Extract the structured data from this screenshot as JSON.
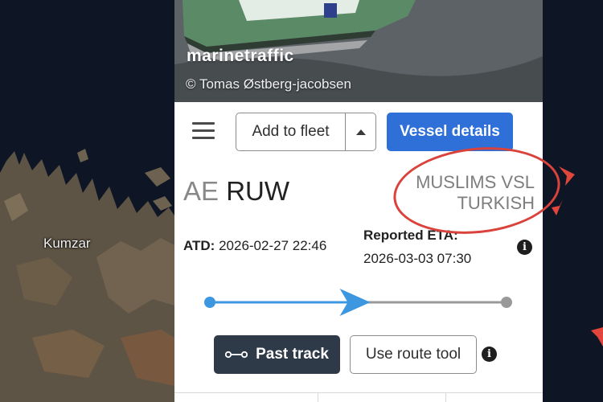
{
  "map": {
    "place_label": "Kumzar",
    "colors": {
      "sea": "#0e1626",
      "land": "#5e5445",
      "marker": "#e0463b"
    },
    "markers": [
      "vessel-marker-icon",
      "vessel-marker-icon",
      "vessel-marker-icon"
    ]
  },
  "photo": {
    "brand": "marinetraffic",
    "credit": "© Tomas Østberg-jacobsen"
  },
  "toolbar": {
    "menu_icon": "hamburger-menu-icon",
    "add_to_fleet_label": "Add to fleet",
    "fleet_dropdown_icon": "caret-up-icon",
    "vessel_details_label": "Vessel details",
    "accent_color": "#2e6fd8"
  },
  "vessel": {
    "flag_code": "AE",
    "name": "RUW",
    "destination_line1": "MUSLIMS VSL",
    "destination_line2": "TURKISH"
  },
  "voyage": {
    "atd_label": "ATD:",
    "atd_value": "2026-02-27 22:46",
    "eta_label": "Reported ETA:",
    "eta_value": "2026-03-03 07:30",
    "progress_fraction": 0.53,
    "progress_color": "#3d97e0"
  },
  "actions": {
    "past_track_label": "Past track",
    "route_tool_label": "Use route tool",
    "past_track_icon": "track-line-icon",
    "info_icon": "info-icon"
  },
  "annotation": {
    "ring_color": "#d9433b"
  }
}
